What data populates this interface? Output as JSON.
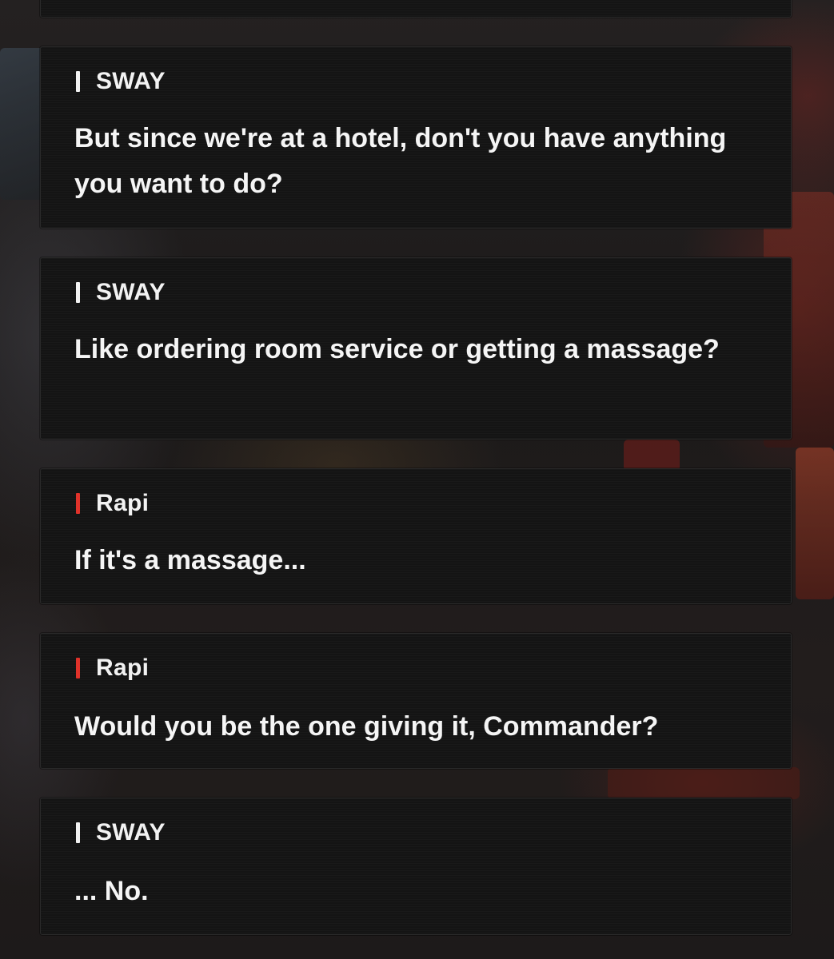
{
  "dialogue": [
    {
      "speaker": "SWAY",
      "marker_color": "#f2f2f2",
      "text": "But since we're at a hotel, don't you have anything you want to do?"
    },
    {
      "speaker": "SWAY",
      "marker_color": "#f2f2f2",
      "text": "Like ordering room service or getting a massage?"
    },
    {
      "speaker": "Rapi",
      "marker_color": "#e0322a",
      "text": "If it's a massage..."
    },
    {
      "speaker": "Rapi",
      "marker_color": "#e0322a",
      "text": "Would you be the one giving it, Commander?"
    },
    {
      "speaker": "SWAY",
      "marker_color": "#f2f2f2",
      "text": "... No."
    }
  ]
}
